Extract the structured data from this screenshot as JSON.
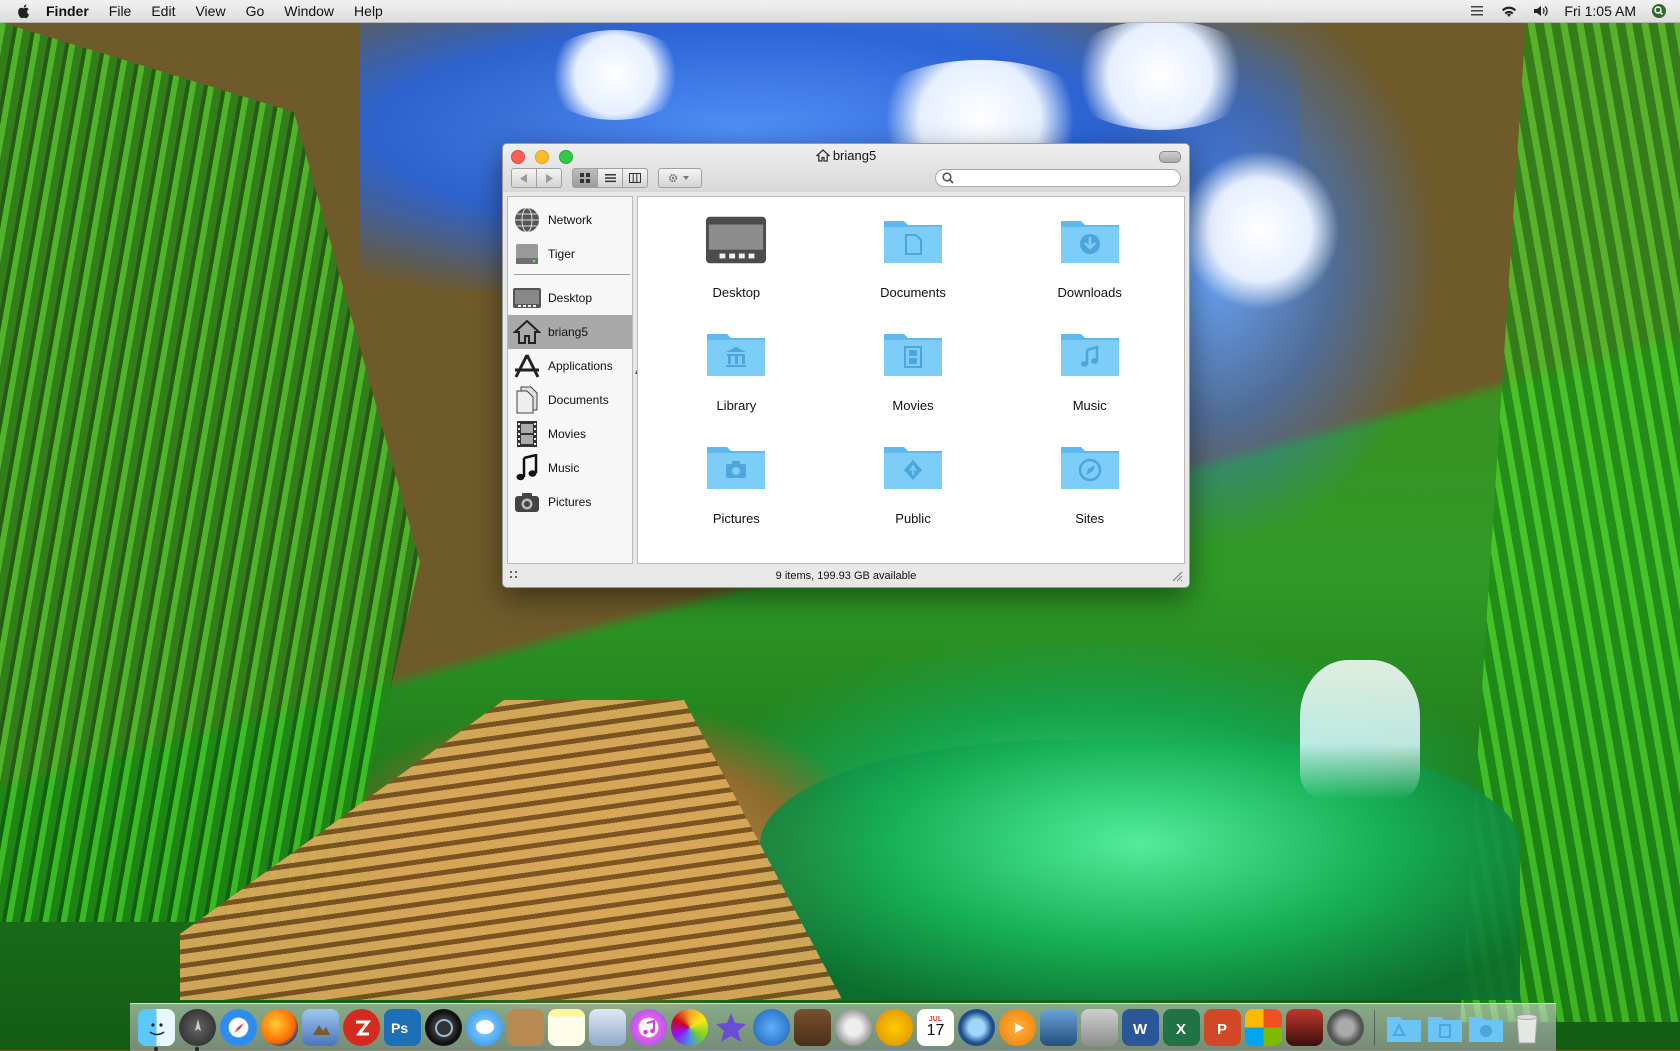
{
  "menubar": {
    "app_name": "Finder",
    "menus": [
      "File",
      "Edit",
      "View",
      "Go",
      "Window",
      "Help"
    ],
    "clock": "Fri 1:05 AM",
    "status_icons": [
      "list-icon",
      "wifi-icon",
      "volume-icon",
      "spotlight-icon"
    ]
  },
  "window": {
    "title": "briang5",
    "search_placeholder": "",
    "status": "9 items, 199.93 GB available",
    "view_mode": "icon"
  },
  "sidebar": {
    "devices": [
      {
        "label": "Network",
        "icon": "globe-icon"
      },
      {
        "label": "Tiger",
        "icon": "hard-drive-icon"
      }
    ],
    "places": [
      {
        "label": "Desktop",
        "icon": "desktop-icon",
        "selected": false
      },
      {
        "label": "briang5",
        "icon": "home-icon",
        "selected": true
      },
      {
        "label": "Applications",
        "icon": "applications-icon",
        "selected": false
      },
      {
        "label": "Documents",
        "icon": "documents-icon",
        "selected": false
      },
      {
        "label": "Movies",
        "icon": "film-icon",
        "selected": false
      },
      {
        "label": "Music",
        "icon": "music-note-icon",
        "selected": false
      },
      {
        "label": "Pictures",
        "icon": "camera-icon",
        "selected": false
      }
    ]
  },
  "items": [
    {
      "label": "Desktop",
      "icon": "desktop-folder-icon"
    },
    {
      "label": "Documents",
      "icon": "documents-folder-icon"
    },
    {
      "label": "Downloads",
      "icon": "downloads-folder-icon"
    },
    {
      "label": "Library",
      "icon": "library-folder-icon"
    },
    {
      "label": "Movies",
      "icon": "movies-folder-icon"
    },
    {
      "label": "Music",
      "icon": "music-folder-icon"
    },
    {
      "label": "Pictures",
      "icon": "pictures-folder-icon"
    },
    {
      "label": "Public",
      "icon": "public-folder-icon"
    },
    {
      "label": "Sites",
      "icon": "sites-folder-icon"
    }
  ],
  "dock": {
    "apps": [
      "finder-icon",
      "launchpad-icon",
      "safari-icon",
      "firefox-icon",
      "preview-icon",
      "filezilla-icon",
      "photoshop-icon",
      "quicktime-x-icon",
      "messages-icon",
      "contacts-icon",
      "notes-icon",
      "preview-images-icon",
      "itunes-icon",
      "photos-icon",
      "imovie-icon",
      "xcode-icon",
      "garageband-icon",
      "dvd-player-icon",
      "headphones-icon",
      "calendar-icon",
      "quicktime-icon",
      "vlc-icon",
      "screen-sharing-icon",
      "remote-icon",
      "word-icon",
      "excel-icon",
      "powerpoint-icon",
      "windows-icon",
      "photo-booth-icon",
      "system-preferences-icon"
    ],
    "stacks": [
      "applications-stack-icon",
      "documents-stack-icon",
      "downloads-stack-icon",
      "trash-icon"
    ],
    "calendar_month": "JUL",
    "calendar_day": "17"
  },
  "colors": {
    "folder_blue": "#6cc3f5",
    "selection_gray": "#a9a9a9",
    "close_red": "#fc5f57",
    "minimize_yellow": "#fdbc2e",
    "zoom_green": "#34c84a"
  }
}
